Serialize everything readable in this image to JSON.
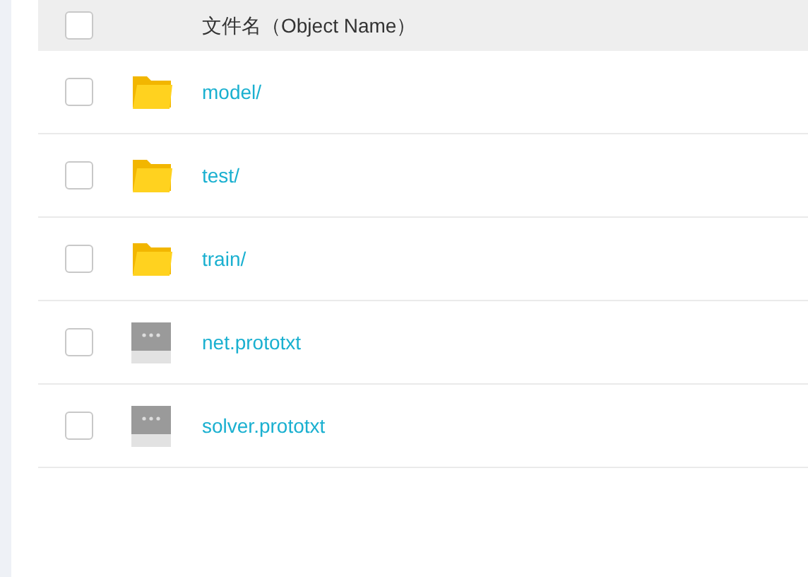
{
  "table": {
    "header": {
      "checked": false,
      "label": "文件名（Object Name）"
    },
    "rows": [
      {
        "kind": "folder",
        "name": "model/",
        "checked": false
      },
      {
        "kind": "folder",
        "name": "test/",
        "checked": false
      },
      {
        "kind": "folder",
        "name": "train/",
        "checked": false
      },
      {
        "kind": "file",
        "name": "net.prototxt",
        "checked": false
      },
      {
        "kind": "file",
        "name": "solver.prototxt",
        "checked": false
      }
    ]
  }
}
